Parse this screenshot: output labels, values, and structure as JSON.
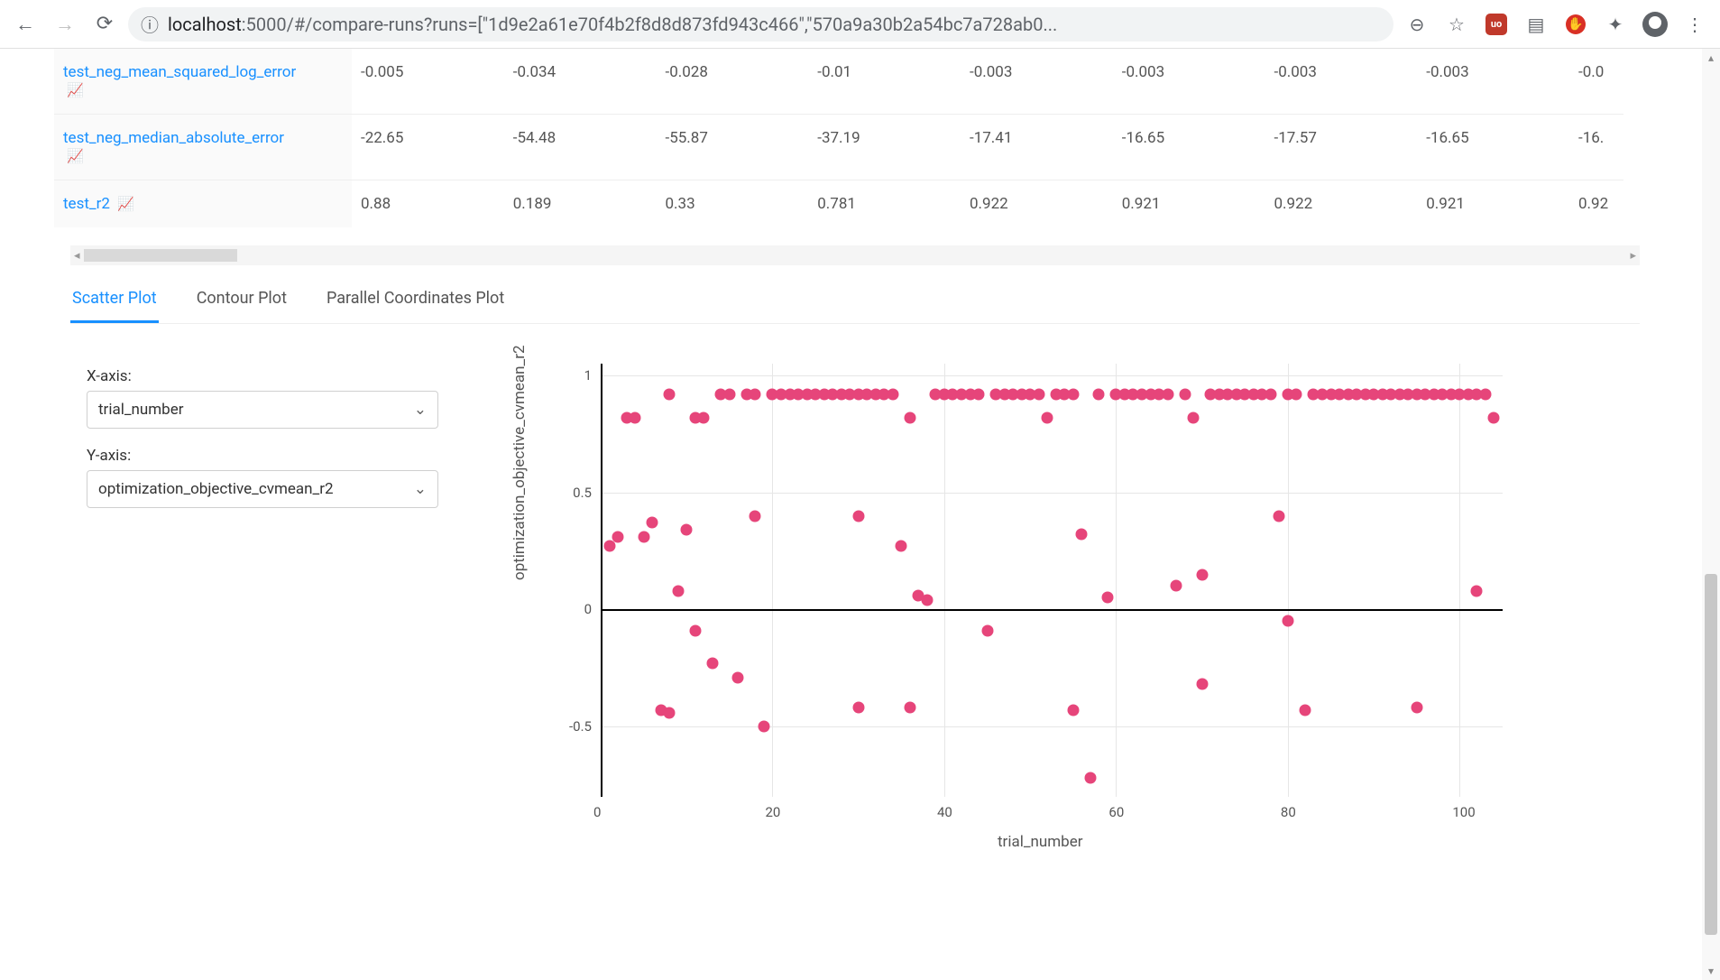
{
  "browser": {
    "url_host": "localhost",
    "url_port": ":5000",
    "url_path": "/#/compare-runs?runs=[\"1d9e2a61e70f4b2f8d8d873fd943c466\",\"570a9a30b2a54bc7a728ab0..."
  },
  "table": {
    "rows": [
      {
        "metric": "test_neg_mean_squared_log_error",
        "cells": [
          "-0.005",
          "-0.034",
          "-0.028",
          "-0.01",
          "-0.003",
          "-0.003",
          "-0.003",
          "-0.003",
          "-0.0"
        ]
      },
      {
        "metric": "test_neg_median_absolute_error",
        "cells": [
          "-22.65",
          "-54.48",
          "-55.87",
          "-37.19",
          "-17.41",
          "-16.65",
          "-17.57",
          "-16.65",
          "-16."
        ]
      },
      {
        "metric": "test_r2",
        "cells": [
          "0.88",
          "0.189",
          "0.33",
          "0.781",
          "0.922",
          "0.921",
          "0.922",
          "0.921",
          "0.92"
        ]
      }
    ]
  },
  "tabs": {
    "scatter": "Scatter Plot",
    "contour": "Contour Plot",
    "parallel": "Parallel Coordinates Plot"
  },
  "controls": {
    "x_label": "X-axis:",
    "x_value": "trial_number",
    "y_label": "Y-axis:",
    "y_value": "optimization_objective_cvmean_r2"
  },
  "chart_data": {
    "type": "scatter",
    "xlabel": "trial_number",
    "ylabel": "optimization_objective_cvmean_r2",
    "xlim": [
      0,
      105
    ],
    "ylim": [
      -0.8,
      1.05
    ],
    "x_ticks": [
      0,
      20,
      40,
      60,
      80,
      100
    ],
    "y_ticks": [
      -0.5,
      0,
      0.5,
      1
    ],
    "color": "#e6457a",
    "series": [
      {
        "name": "trials",
        "points": [
          [
            1,
            0.27
          ],
          [
            2,
            0.31
          ],
          [
            3,
            0.82
          ],
          [
            4,
            0.82
          ],
          [
            5,
            0.31
          ],
          [
            6,
            0.37
          ],
          [
            7,
            -0.43
          ],
          [
            8,
            -0.44
          ],
          [
            8,
            0.92
          ],
          [
            9,
            0.08
          ],
          [
            10,
            0.34
          ],
          [
            11,
            0.82
          ],
          [
            11,
            -0.09
          ],
          [
            12,
            0.82
          ],
          [
            13,
            -0.23
          ],
          [
            14,
            0.92
          ],
          [
            15,
            0.92
          ],
          [
            16,
            -0.29
          ],
          [
            17,
            0.92
          ],
          [
            18,
            0.4
          ],
          [
            18,
            0.92
          ],
          [
            19,
            -0.5
          ],
          [
            20,
            0.92
          ],
          [
            21,
            0.92
          ],
          [
            22,
            0.92
          ],
          [
            23,
            0.92
          ],
          [
            24,
            0.92
          ],
          [
            25,
            0.92
          ],
          [
            26,
            0.92
          ],
          [
            27,
            0.92
          ],
          [
            28,
            0.92
          ],
          [
            29,
            0.92
          ],
          [
            30,
            0.4
          ],
          [
            30,
            0.92
          ],
          [
            30,
            -0.42
          ],
          [
            31,
            0.92
          ],
          [
            32,
            0.92
          ],
          [
            33,
            0.92
          ],
          [
            34,
            0.92
          ],
          [
            35,
            0.27
          ],
          [
            36,
            0.82
          ],
          [
            36,
            -0.42
          ],
          [
            37,
            0.06
          ],
          [
            38,
            0.04
          ],
          [
            39,
            0.92
          ],
          [
            40,
            0.92
          ],
          [
            41,
            0.92
          ],
          [
            42,
            0.92
          ],
          [
            43,
            0.92
          ],
          [
            44,
            0.92
          ],
          [
            45,
            -0.09
          ],
          [
            46,
            0.92
          ],
          [
            47,
            0.92
          ],
          [
            48,
            0.92
          ],
          [
            49,
            0.92
          ],
          [
            50,
            0.92
          ],
          [
            51,
            0.92
          ],
          [
            52,
            0.82
          ],
          [
            53,
            0.92
          ],
          [
            54,
            0.92
          ],
          [
            55,
            0.92
          ],
          [
            55,
            -0.43
          ],
          [
            56,
            0.32
          ],
          [
            57,
            -0.72
          ],
          [
            58,
            0.92
          ],
          [
            59,
            0.05
          ],
          [
            60,
            0.92
          ],
          [
            61,
            0.92
          ],
          [
            62,
            0.92
          ],
          [
            63,
            0.92
          ],
          [
            64,
            0.92
          ],
          [
            65,
            0.92
          ],
          [
            66,
            0.92
          ],
          [
            67,
            0.1
          ],
          [
            68,
            0.92
          ],
          [
            69,
            0.82
          ],
          [
            70,
            0.15
          ],
          [
            70,
            -0.32
          ],
          [
            71,
            0.92
          ],
          [
            72,
            0.92
          ],
          [
            73,
            0.92
          ],
          [
            74,
            0.92
          ],
          [
            75,
            0.92
          ],
          [
            76,
            0.92
          ],
          [
            77,
            0.92
          ],
          [
            78,
            0.92
          ],
          [
            79,
            0.4
          ],
          [
            80,
            -0.05
          ],
          [
            80,
            0.92
          ],
          [
            81,
            0.92
          ],
          [
            82,
            -0.43
          ],
          [
            83,
            0.92
          ],
          [
            84,
            0.92
          ],
          [
            85,
            0.92
          ],
          [
            86,
            0.92
          ],
          [
            87,
            0.92
          ],
          [
            88,
            0.92
          ],
          [
            89,
            0.92
          ],
          [
            90,
            0.92
          ],
          [
            91,
            0.92
          ],
          [
            92,
            0.92
          ],
          [
            93,
            0.92
          ],
          [
            94,
            0.92
          ],
          [
            95,
            -0.42
          ],
          [
            95,
            0.92
          ],
          [
            96,
            0.92
          ],
          [
            97,
            0.92
          ],
          [
            98,
            0.92
          ],
          [
            99,
            0.92
          ],
          [
            100,
            0.92
          ],
          [
            101,
            0.92
          ],
          [
            102,
            0.92
          ],
          [
            102,
            0.08
          ],
          [
            103,
            0.92
          ],
          [
            104,
            0.82
          ]
        ]
      }
    ]
  }
}
